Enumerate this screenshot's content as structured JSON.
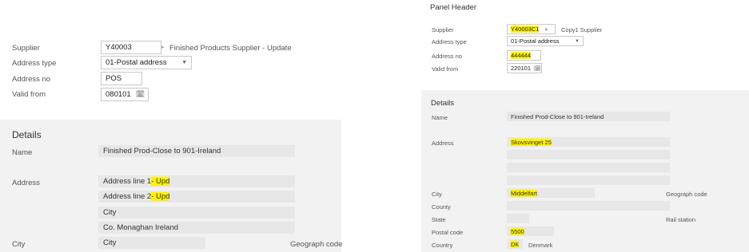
{
  "left": {
    "header": {
      "supplier_label": "Supplier",
      "supplier_value": "Y40003",
      "supplier_name": "Finished Products Supplier - Update",
      "address_type_label": "Address type",
      "address_type_value": "01-Postal address",
      "address_no_label": "Address no",
      "address_no_value": "POS",
      "valid_from_label": "Valid from",
      "valid_from_value": "080101"
    },
    "details": {
      "title": "Details",
      "name_label": "Name",
      "name_value": "Finished Prod-Close to 901-Ireland",
      "address_label": "Address",
      "address_line1_base": "Address line 1 ",
      "address_line1_upd": "- Upd",
      "address_line2_base": "Address line 2 ",
      "address_line2_upd": "- Upd",
      "address_line3": "City",
      "address_line4": "Co. Monaghan Ireland",
      "city_label": "City",
      "city_value": "City",
      "geograph_label": "Geograph code"
    }
  },
  "right": {
    "panel_header": "Panel Header",
    "header": {
      "supplier_label": "Supplier",
      "supplier_value": "Y40003C1",
      "supplier_name": "Copy1 Supplier",
      "address_type_label": "Address type",
      "address_type_value": "01-Postal address",
      "address_no_label": "Address no",
      "address_no_value": "444444",
      "valid_from_label": "Valid from",
      "valid_from_value": "220101"
    },
    "details": {
      "title": "Details",
      "name_label": "Name",
      "name_value": "Finished Prod-Close to 901-Ireland",
      "address_label": "Address",
      "address_line1": "Skovsvinget 25",
      "city_label": "City",
      "city_value": "Middelfart",
      "geograph_label": "Geograph code",
      "county_label": "County",
      "state_label": "State",
      "rail_station_label": "Rail station",
      "postal_code_label": "Postal code",
      "postal_code_value": "5500",
      "country_label": "Country",
      "country_code": "DK",
      "country_name": "Denmark"
    }
  },
  "colors": {
    "highlight": "#fff200",
    "panel_bg": "#f2f2f2",
    "readonly_bg": "#e7e7e7"
  }
}
